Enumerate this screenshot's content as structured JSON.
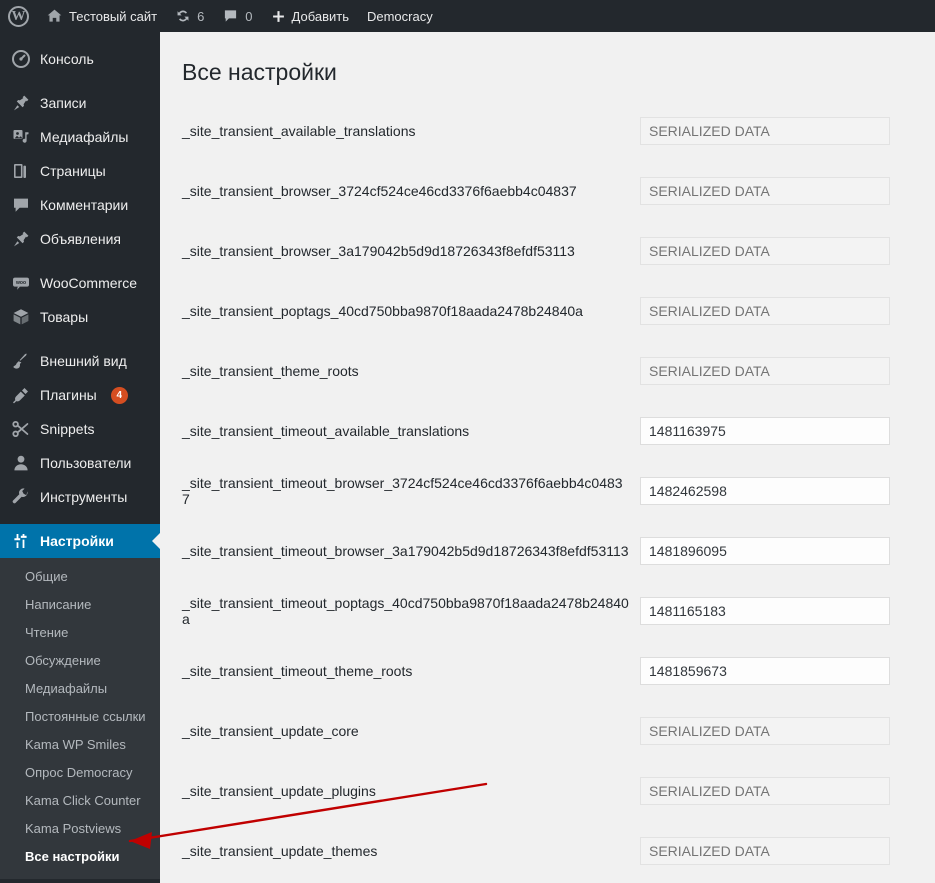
{
  "adminbar": {
    "wp_logo": "W",
    "site_name": "Тестовый сайт",
    "updates_count": "6",
    "comments_count": "0",
    "new_label": "Добавить",
    "plugin_item": "Democracy"
  },
  "sidebar": {
    "items": [
      {
        "label": "Консоль",
        "icon": "dashboard-icon",
        "current": false,
        "badge": ""
      },
      {
        "label": "Записи",
        "icon": "pin-icon",
        "current": false,
        "badge": ""
      },
      {
        "label": "Медиафайлы",
        "icon": "media-icon",
        "current": false,
        "badge": ""
      },
      {
        "label": "Страницы",
        "icon": "page-icon",
        "current": false,
        "badge": ""
      },
      {
        "label": "Комментарии",
        "icon": "comment-icon",
        "current": false,
        "badge": ""
      },
      {
        "label": "Объявления",
        "icon": "pin-icon",
        "current": false,
        "badge": ""
      },
      {
        "label": "WooCommerce",
        "icon": "woo-icon",
        "current": false,
        "badge": ""
      },
      {
        "label": "Товары",
        "icon": "products-icon",
        "current": false,
        "badge": ""
      },
      {
        "label": "Внешний вид",
        "icon": "brush-icon",
        "current": false,
        "badge": ""
      },
      {
        "label": "Плагины",
        "icon": "plug-icon",
        "current": false,
        "badge": "4"
      },
      {
        "label": "Snippets",
        "icon": "scissors-icon",
        "current": false,
        "badge": ""
      },
      {
        "label": "Пользователи",
        "icon": "user-icon",
        "current": false,
        "badge": ""
      },
      {
        "label": "Инструменты",
        "icon": "wrench-icon",
        "current": false,
        "badge": ""
      },
      {
        "label": "Настройки",
        "icon": "settings-icon",
        "current": true,
        "badge": ""
      }
    ],
    "submenu": [
      {
        "label": "Общие",
        "current": false
      },
      {
        "label": "Написание",
        "current": false
      },
      {
        "label": "Чтение",
        "current": false
      },
      {
        "label": "Обсуждение",
        "current": false
      },
      {
        "label": "Медиафайлы",
        "current": false
      },
      {
        "label": "Постоянные ссылки",
        "current": false
      },
      {
        "label": "Kama WP Smiles",
        "current": false
      },
      {
        "label": "Опрос Democracy",
        "current": false
      },
      {
        "label": "Kama Click Counter",
        "current": false
      },
      {
        "label": "Kama Postviews",
        "current": false
      },
      {
        "label": "Все настройки",
        "current": true
      }
    ]
  },
  "page": {
    "title": "Все настройки",
    "serialized_placeholder": "SERIALIZED DATA",
    "rows": [
      {
        "name": "_site_transient_available_translations",
        "value": "",
        "serialized": true
      },
      {
        "name": "_site_transient_browser_3724cf524ce46cd3376f6aebb4c04837",
        "value": "",
        "serialized": true
      },
      {
        "name": "_site_transient_browser_3a179042b5d9d18726343f8efdf53113",
        "value": "",
        "serialized": true
      },
      {
        "name": "_site_transient_poptags_40cd750bba9870f18aada2478b24840a",
        "value": "",
        "serialized": true
      },
      {
        "name": "_site_transient_theme_roots",
        "value": "",
        "serialized": true
      },
      {
        "name": "_site_transient_timeout_available_translations",
        "value": "1481163975",
        "serialized": false
      },
      {
        "name": "_site_transient_timeout_browser_3724cf524ce46cd3376f6aebb4c04837",
        "value": "1482462598",
        "serialized": false
      },
      {
        "name": "_site_transient_timeout_browser_3a179042b5d9d18726343f8efdf53113",
        "value": "1481896095",
        "serialized": false
      },
      {
        "name": "_site_transient_timeout_poptags_40cd750bba9870f18aada2478b24840a",
        "value": "1481165183",
        "serialized": false
      },
      {
        "name": "_site_transient_timeout_theme_roots",
        "value": "1481859673",
        "serialized": false
      },
      {
        "name": "_site_transient_update_core",
        "value": "",
        "serialized": true
      },
      {
        "name": "_site_transient_update_plugins",
        "value": "",
        "serialized": true
      },
      {
        "name": "_site_transient_update_themes",
        "value": "",
        "serialized": true
      }
    ]
  },
  "annotation": {
    "color": "#c00000",
    "kind": "arrow-pointing-to-all-settings"
  }
}
